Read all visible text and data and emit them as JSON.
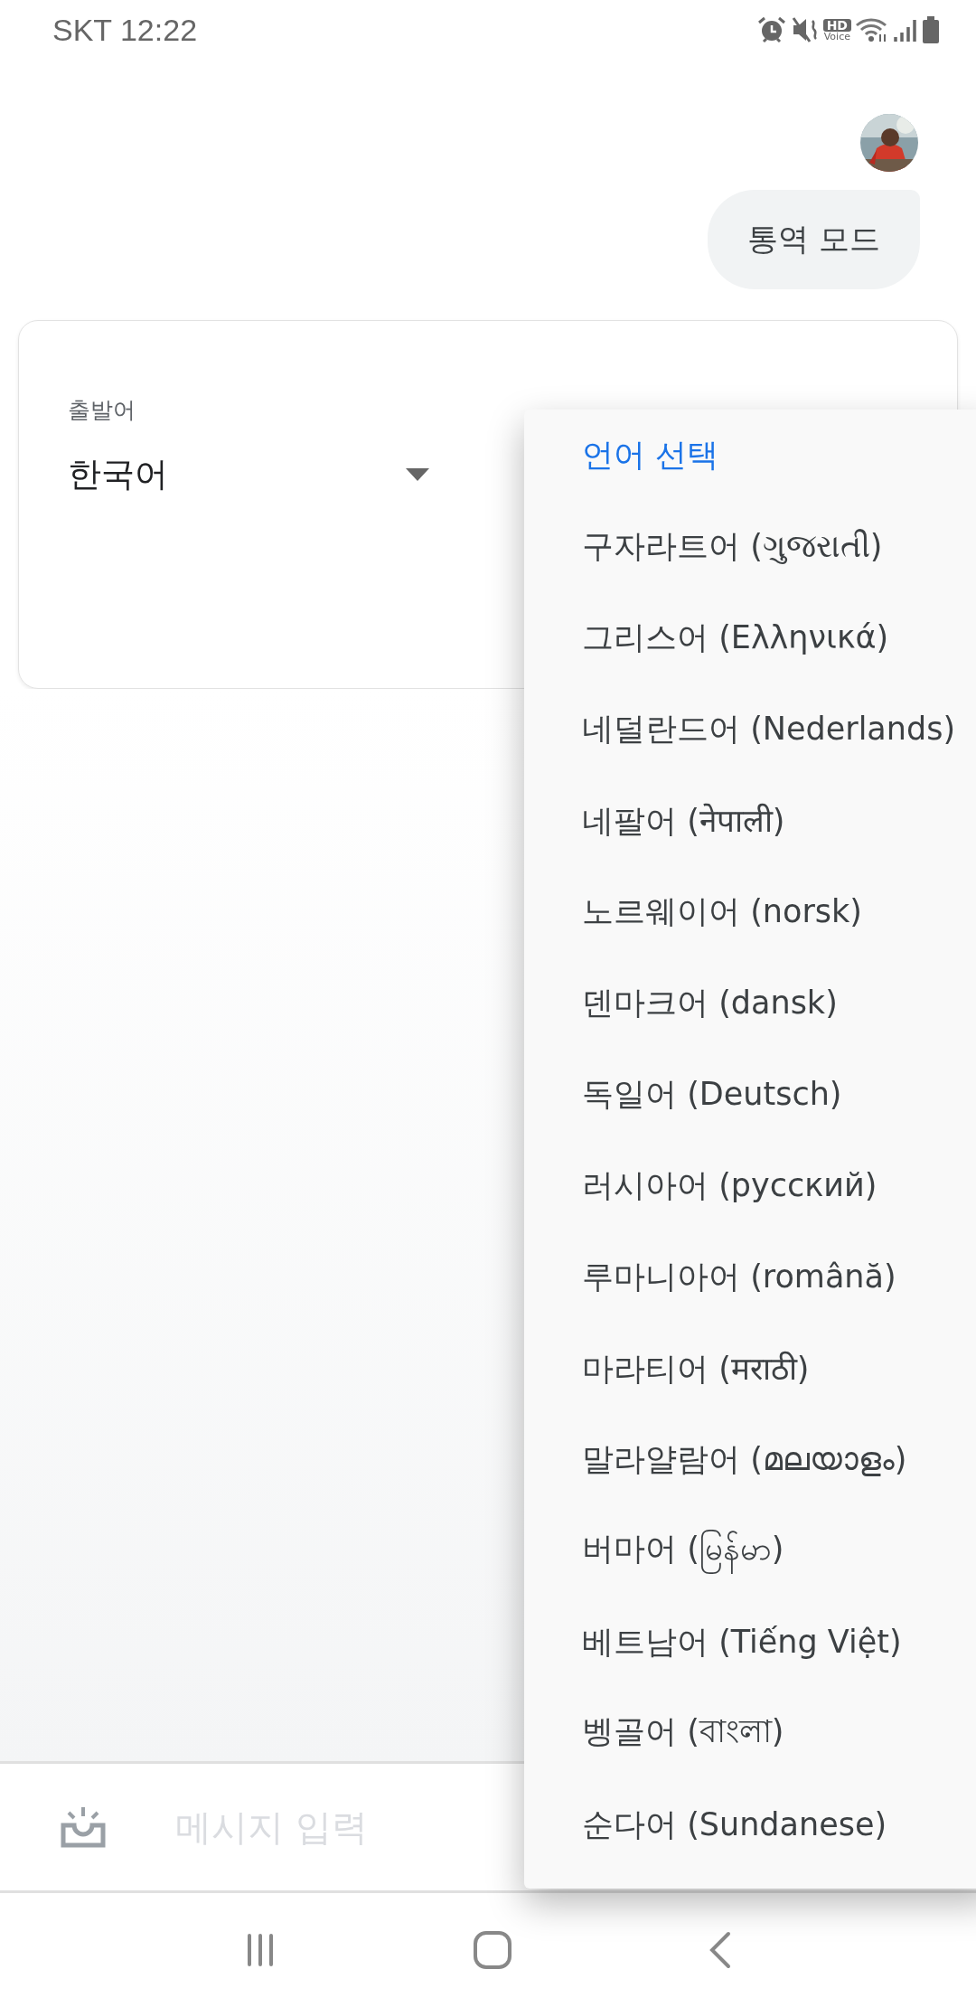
{
  "status_bar": {
    "carrier_time": "SKT 12:22",
    "hd_voice": {
      "top": "HD",
      "bottom": "Voice"
    }
  },
  "chat": {
    "bubble": "통역 모드"
  },
  "card": {
    "source": {
      "label": "출발어",
      "value": "한국어"
    }
  },
  "language_menu": {
    "title": "언어 선택",
    "items": [
      {
        "label": "구자라트어 (ગુજરાતી)"
      },
      {
        "label": "그리스어 (Ελληνικά)"
      },
      {
        "label": "네덜란드어 (Nederlands)"
      },
      {
        "label": "네팔어 (नेपाली)"
      },
      {
        "label": "노르웨이어 (norsk)"
      },
      {
        "label": "덴마크어 (dansk)"
      },
      {
        "label": "독일어 (Deutsch)"
      },
      {
        "label": "러시아어 (русский)"
      },
      {
        "label": "루마니아어 (română)"
      },
      {
        "label": "마라티어 (मराठी)"
      },
      {
        "label": "말라얄람어 (മലയാളം)"
      },
      {
        "label": "버마어 (မြန်မာ)"
      },
      {
        "label": "베트남어 (Tiếng Việt)"
      },
      {
        "label": "벵골어 (বাংলা)"
      },
      {
        "label": "순다어 (Sundanese)"
      }
    ]
  },
  "input_bar": {
    "placeholder": "메시지 입력"
  }
}
